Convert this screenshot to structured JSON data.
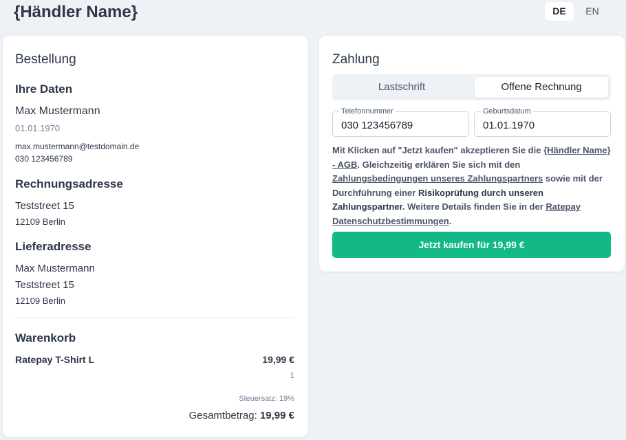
{
  "header": {
    "merchant_name": "{Händler Name}"
  },
  "languages": [
    {
      "label": "DE",
      "active": true
    },
    {
      "label": "EN",
      "active": false
    }
  ],
  "order": {
    "title": "Bestellung",
    "personal": {
      "heading": "Ihre Daten",
      "name": "Max Mustermann",
      "dob": "01.01.1970",
      "email": "max.mustermann@testdomain.de",
      "phone": "030 123456789"
    },
    "billing": {
      "heading": "Rechnungsadresse",
      "street": "Teststreet 15",
      "city": "12109 Berlin"
    },
    "shipping": {
      "heading": "Lieferadresse",
      "name": "Max Mustermann",
      "street": "Teststreet 15",
      "city": "12109 Berlin"
    },
    "cart": {
      "heading": "Warenkorb",
      "item_name": "Ratepay T-Shirt L",
      "item_price": "19,99 €",
      "item_qty": "1",
      "tax_label": "Steuersatz: 19%",
      "total_label": "Gesamtbetrag:",
      "total_value": "19,99 €"
    }
  },
  "payment": {
    "title": "Zahlung",
    "tabs": [
      {
        "label": "Lastschrift",
        "active": false
      },
      {
        "label": "Offene Rechnung",
        "active": true
      }
    ],
    "phone_field": {
      "label": "Telefonnummer",
      "value": "030 123456789"
    },
    "dob_field": {
      "label": "Geburtsdatum",
      "value": "01.01.1970"
    },
    "legal": {
      "p1": "Mit Klicken auf \"Jetzt kaufen\" akzeptieren Sie die ",
      "link_agb": "{Händler Name} - AGB",
      "p2": ". Gleichzeitig erklären Sie sich mit den ",
      "link_terms": "Zahlungsbedingungen unseres Zahlungspartners",
      "p3": " sowie mit der Durchführung einer ",
      "bold_risk": "Risikoprüfung durch unseren Zahlungspartner",
      "p4": ". Weitere Details finden Sie in der ",
      "link_privacy": "Ratepay Datenschutzbestimmungen",
      "p5": "."
    },
    "buy_button": "Jetzt kaufen für 19,99 €"
  }
}
